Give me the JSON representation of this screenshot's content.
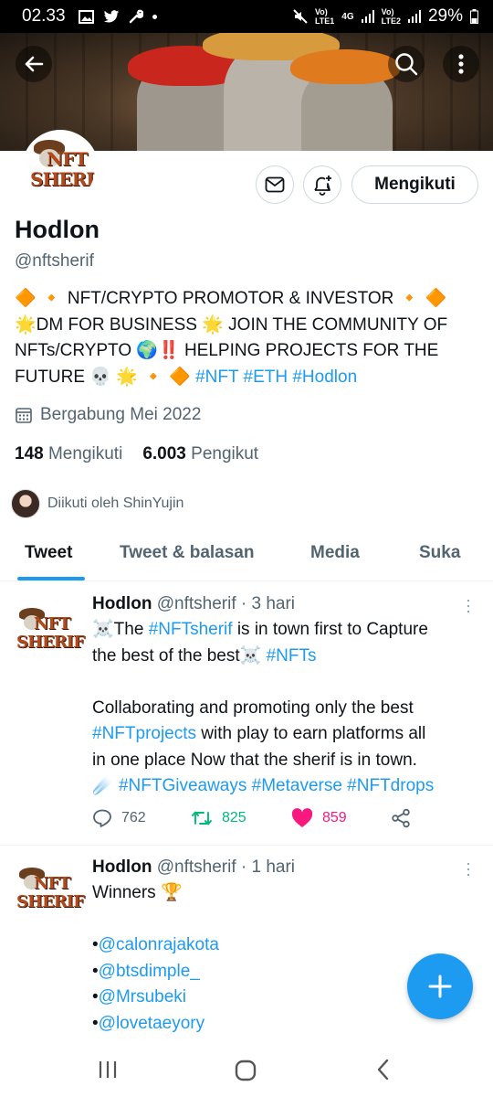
{
  "status_bar": {
    "time": "02.33",
    "net1": "Vo)\nLTE1",
    "net2_top": "4G",
    "net3": "Vo)\nLTE2",
    "battery": "29%"
  },
  "profile": {
    "logo_line1": "NFT",
    "logo_line2": "SHERIF",
    "follow_label": "Mengikuti",
    "name": "Hodlon",
    "handle": "@nftsherif",
    "bio_line1": "🔶 🔸 NFT/CRYPTO PROMOTOR & INVESTOR 🔸 🔶",
    "bio_line2": "🌟DM FOR BUSINESS 🌟 JOIN THE COMMUNITY OF",
    "bio_line3": "NFTs/CRYPTO 🌍‼️ HELPING PROJECTS FOR THE",
    "bio_line4_prefix": "FUTURE 💀 🌟 🔸 🔶 ",
    "bio_hashtags": "#NFT #ETH #Hodlon",
    "joined": "Bergabung Mei 2022",
    "following_count": "148",
    "following_label": "Mengikuti",
    "followers_count": "6.003",
    "followers_label": "Pengikut",
    "followed_by": "Diikuti oleh ShinYujin"
  },
  "tabs": [
    "Tweet",
    "Tweet & balasan",
    "Media",
    "Suka"
  ],
  "tweets": [
    {
      "name": "Hodlon",
      "meta": "@nftsherif · 3 hari",
      "l1_a": "☠️The ",
      "l1_tag": "#NFTsherif",
      "l1_b": " is in town first to Capture",
      "l2_a": "the best of the best☠️ ",
      "l2_tag": "#NFTs",
      "l3": "Collaborating and promoting only the best",
      "l4_tag": "#NFTprojects",
      "l4_b": " with play to earn platforms all",
      "l5": "in one place Now that the sherif is in town.",
      "l6_a": "☄️ ",
      "l6_tags": "#NFTGiveaways #Metaverse #NFTdrops",
      "replies": "762",
      "retweets": "825",
      "likes": "859"
    },
    {
      "name": "Hodlon",
      "meta": "@nftsherif · 1 hari",
      "l1": "Winners 🏆",
      "mention1": "@calonrajakota",
      "mention2": "@btsdimple_",
      "mention3": "@Mrsubeki",
      "mention4": "@lovetaeyory",
      "bullet": "•"
    }
  ],
  "colors": {
    "accent": "#1d9bf0",
    "retweet": "#00ba7c",
    "like": "#f91880",
    "text": "#0f1419",
    "muted": "#536471"
  }
}
